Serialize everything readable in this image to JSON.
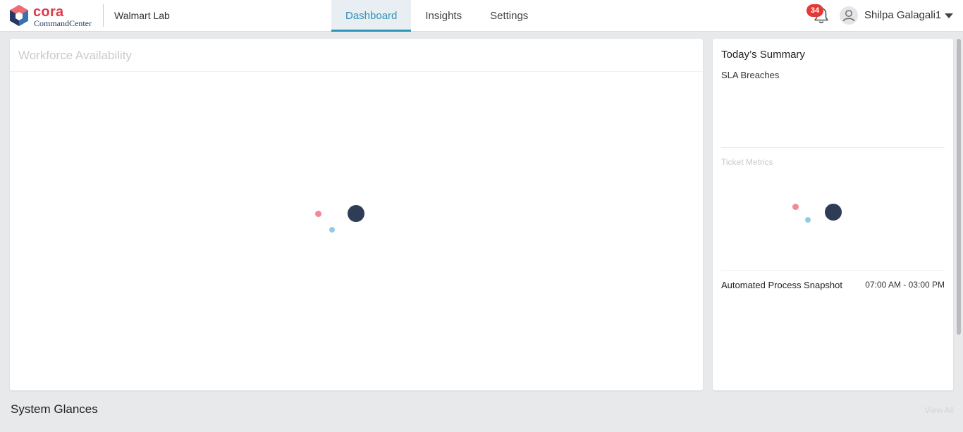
{
  "app": {
    "logo_word": "cora",
    "logo_sub": "CommandCenter",
    "org_name": "Walmart Lab"
  },
  "nav": {
    "tabs": [
      {
        "label": "Dashboard",
        "active": true
      },
      {
        "label": "Insights",
        "active": false
      },
      {
        "label": "Settings",
        "active": false
      }
    ]
  },
  "header": {
    "notification_count": "34",
    "user_name": "Shilpa Galagali1",
    "icons": [
      "bell-icon",
      "user-avatar-icon",
      "caret-down-icon"
    ]
  },
  "workforce": {
    "title": "Workforce Availability",
    "loading": true
  },
  "summary": {
    "title": "Today’s Summary",
    "sla_label": "SLA Breaches",
    "ticket_label": "Ticket Metrics",
    "ticket_loading": true,
    "aps_label": "Automated Process Snapshot",
    "aps_time": "07:00 AM - 03:00 PM"
  },
  "footer": {
    "section_title": "System Glances",
    "view_all": "View All"
  },
  "colors": {
    "accent": "#2d93b8",
    "badge": "#e53935",
    "brand_red": "#e0394a",
    "brand_navy": "#243a64",
    "loader_red": "#f08a93",
    "loader_blue": "#8fcde6",
    "loader_dark": "#2e3d55"
  }
}
